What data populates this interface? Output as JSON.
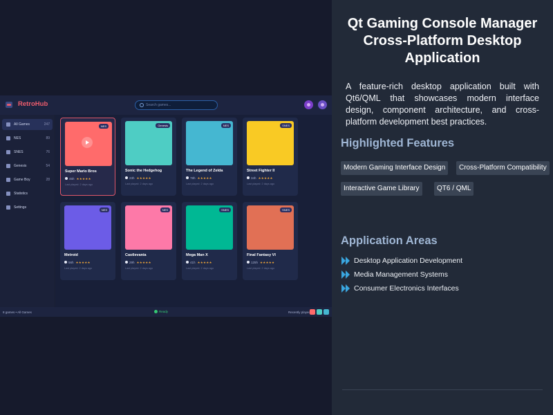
{
  "app": {
    "name": "RetroHub",
    "search_placeholder": "Search games...",
    "sidebar": [
      {
        "label": "All Games",
        "count": "247",
        "icon": "gamepad-icon",
        "active": true
      },
      {
        "label": "NES",
        "count": "89",
        "icon": "nes-icon",
        "active": false
      },
      {
        "label": "SNES",
        "count": "76",
        "icon": "snes-icon",
        "active": false
      },
      {
        "label": "Genesis",
        "count": "54",
        "icon": "genesis-icon",
        "active": false
      },
      {
        "label": "Game Boy",
        "count": "28",
        "icon": "gameboy-icon",
        "active": false
      },
      {
        "label": "Statistics",
        "count": "",
        "icon": "chart-icon",
        "active": false
      },
      {
        "label": "Settings",
        "count": "",
        "icon": "gear-icon",
        "active": false
      }
    ],
    "games": [
      {
        "title": "Super Mario Bros",
        "platform": "NES",
        "hours": "45h",
        "stars": "★★★★★",
        "last": "Last played: 2 days ago",
        "color": "#ff6b6b",
        "selected": true
      },
      {
        "title": "Sonic the Hedgehog",
        "platform": "Genesis",
        "hours": "23h",
        "stars": "★★★★★",
        "last": "Last played: 2 days ago",
        "color": "#4ecdc4",
        "selected": false
      },
      {
        "title": "The Legend of Zelda",
        "platform": "NES",
        "hours": "78h",
        "stars": "★★★★★",
        "last": "Last played: 2 days ago",
        "color": "#45b7d1",
        "selected": false
      },
      {
        "title": "Street Fighter II",
        "platform": "SNES",
        "hours": "34h",
        "stars": "★★★★★",
        "last": "Last played: 2 days ago",
        "color": "#f9ca24",
        "selected": false
      },
      {
        "title": "Metroid",
        "platform": "NES",
        "hours": "56h",
        "stars": "★★★★★",
        "last": "Last played: 2 days ago",
        "color": "#6c5ce7",
        "selected": false
      },
      {
        "title": "Castlevania",
        "platform": "NES",
        "hours": "29h",
        "stars": "★★★★★",
        "last": "Last played: 2 days ago",
        "color": "#fd79a8",
        "selected": false
      },
      {
        "title": "Mega Man X",
        "platform": "SNES",
        "hours": "41h",
        "stars": "★★★★★",
        "last": "Last played: 2 days ago",
        "color": "#00b894",
        "selected": false
      },
      {
        "title": "Final Fantasy VI",
        "platform": "SNES",
        "hours": "125h",
        "stars": "★★★★★",
        "last": "Last played: 2 days ago",
        "color": "#e17055",
        "selected": false
      }
    ],
    "status": {
      "left": "8 games • All Games",
      "center": "Ready",
      "right": "Recently played:",
      "recent_colors": [
        "#ff6b6b",
        "#4ecdc4",
        "#45b7d1"
      ]
    },
    "colors": {
      "accent": "#ef5d6d",
      "ready": "#35c873"
    }
  },
  "panel": {
    "title_lines": [
      "Qt Gaming Console Manager",
      "Cross-Platform Desktop",
      "Application"
    ],
    "description": "A feature-rich desktop application built with Qt6/QML that showcases modern interface design, component architecture, and cross-platform development best practices.",
    "features_heading": "Highlighted Features",
    "features": [
      "Modern Gaming Interface Design",
      "Cross-Platform Compatibility",
      "Interactive Game Library",
      "QT6 / QML"
    ],
    "areas_heading": "Application Areas",
    "areas": [
      "Desktop Application Development",
      "Media Management Systems",
      "Consumer Electronics Interfaces"
    ]
  }
}
